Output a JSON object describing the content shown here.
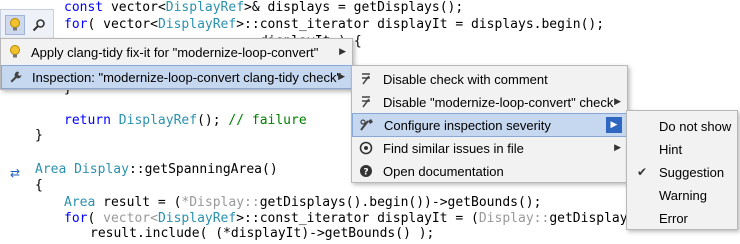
{
  "code": {
    "line1": {
      "a": "const ",
      "b": "vector",
      "c": "<",
      "d": "DisplayRef",
      "e": ">& displays = getDisplays();"
    },
    "line2": {
      "a": "for",
      "b": "( ",
      "c": "vector",
      "d": "<",
      "e": "DisplayRef",
      "f": ">::",
      "g": "const_iterator",
      "h": " displayIt = displays.begin();"
    },
    "line3": {
      "a": "displayIt ) {"
    },
    "line4": {
      "a": "}"
    },
    "line5": {
      "a": "return ",
      "b": "DisplayRef",
      "c": "(); ",
      "d": "// failure"
    },
    "line6": {
      "a": "}"
    },
    "line7": {
      "a": "Area ",
      "b": "Display",
      "c": "::getSpanningArea()"
    },
    "line8": {
      "a": "{"
    },
    "line9": {
      "a": "Area",
      "b": " result = (",
      "c": "*Display::",
      "d": "getDisplays().begin())->getBounds();"
    },
    "line10": {
      "a": "for",
      "b": "( ",
      "c": "vector",
      "d": "<",
      "e": "DisplayRef",
      "f": ">::",
      "g": "const_iterator",
      "h": " displayIt = (",
      "i": "Display::",
      "j": "getDisplays().begi"
    },
    "line11": {
      "a": "result.include( (*displayIt)->getBounds() );"
    }
  },
  "bulb_bar": {
    "icons": [
      "lightbulb-icon",
      "inspect-icon"
    ]
  },
  "menu1": {
    "items": [
      {
        "label": "Apply clang-tidy fix-it for \"modernize-loop-convert\"",
        "icon": "lightbulb-icon"
      },
      {
        "label": "Inspection: \"modernize-loop-convert clang-tidy check\"",
        "icon": "wrench-icon"
      }
    ]
  },
  "menu2": {
    "items": [
      {
        "label": "Disable check with comment",
        "icon": "disable-icon"
      },
      {
        "label": "Disable \"modernize-loop-convert\" check",
        "icon": "disable-icon"
      },
      {
        "label": "Configure inspection severity",
        "icon": "configure-icon"
      },
      {
        "label": "Find similar issues in file",
        "icon": "find-icon"
      },
      {
        "label": "Open documentation",
        "icon": "doc-icon"
      }
    ]
  },
  "menu3": {
    "items": [
      {
        "label": "Do not show"
      },
      {
        "label": "Hint"
      },
      {
        "label": "Suggestion",
        "checked": true
      },
      {
        "label": "Warning"
      },
      {
        "label": "Error"
      }
    ]
  }
}
